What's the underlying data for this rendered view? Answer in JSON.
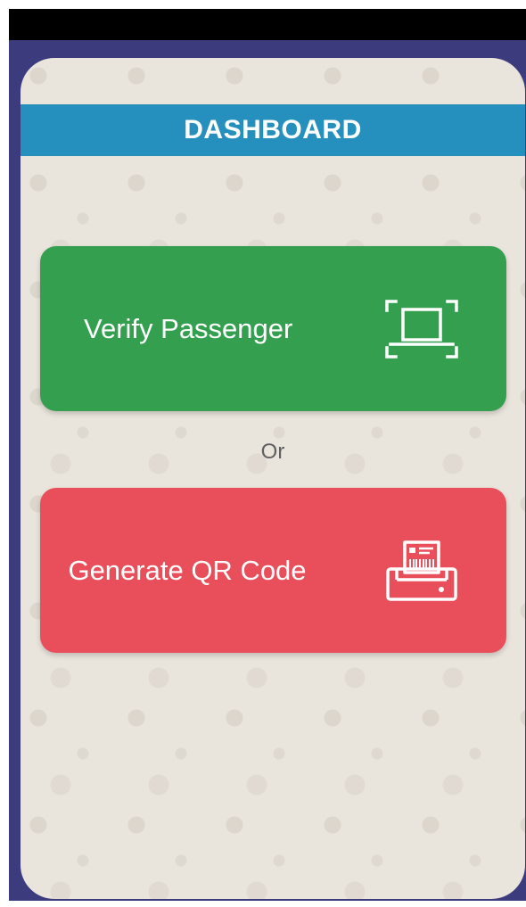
{
  "header": {
    "title": "DASHBOARD"
  },
  "actions": {
    "verify_label": "Verify Passenger",
    "verify_icon": "scan-frame-icon",
    "separator": "Or",
    "generate_label": "Generate QR Code",
    "generate_icon": "printer-ticket-icon"
  },
  "colors": {
    "header_bar": "#2590bd",
    "verify_button": "#34a04f",
    "generate_button": "#e94f5a",
    "frame": "#3b3b7e",
    "card_background": "#e9e4dc"
  }
}
